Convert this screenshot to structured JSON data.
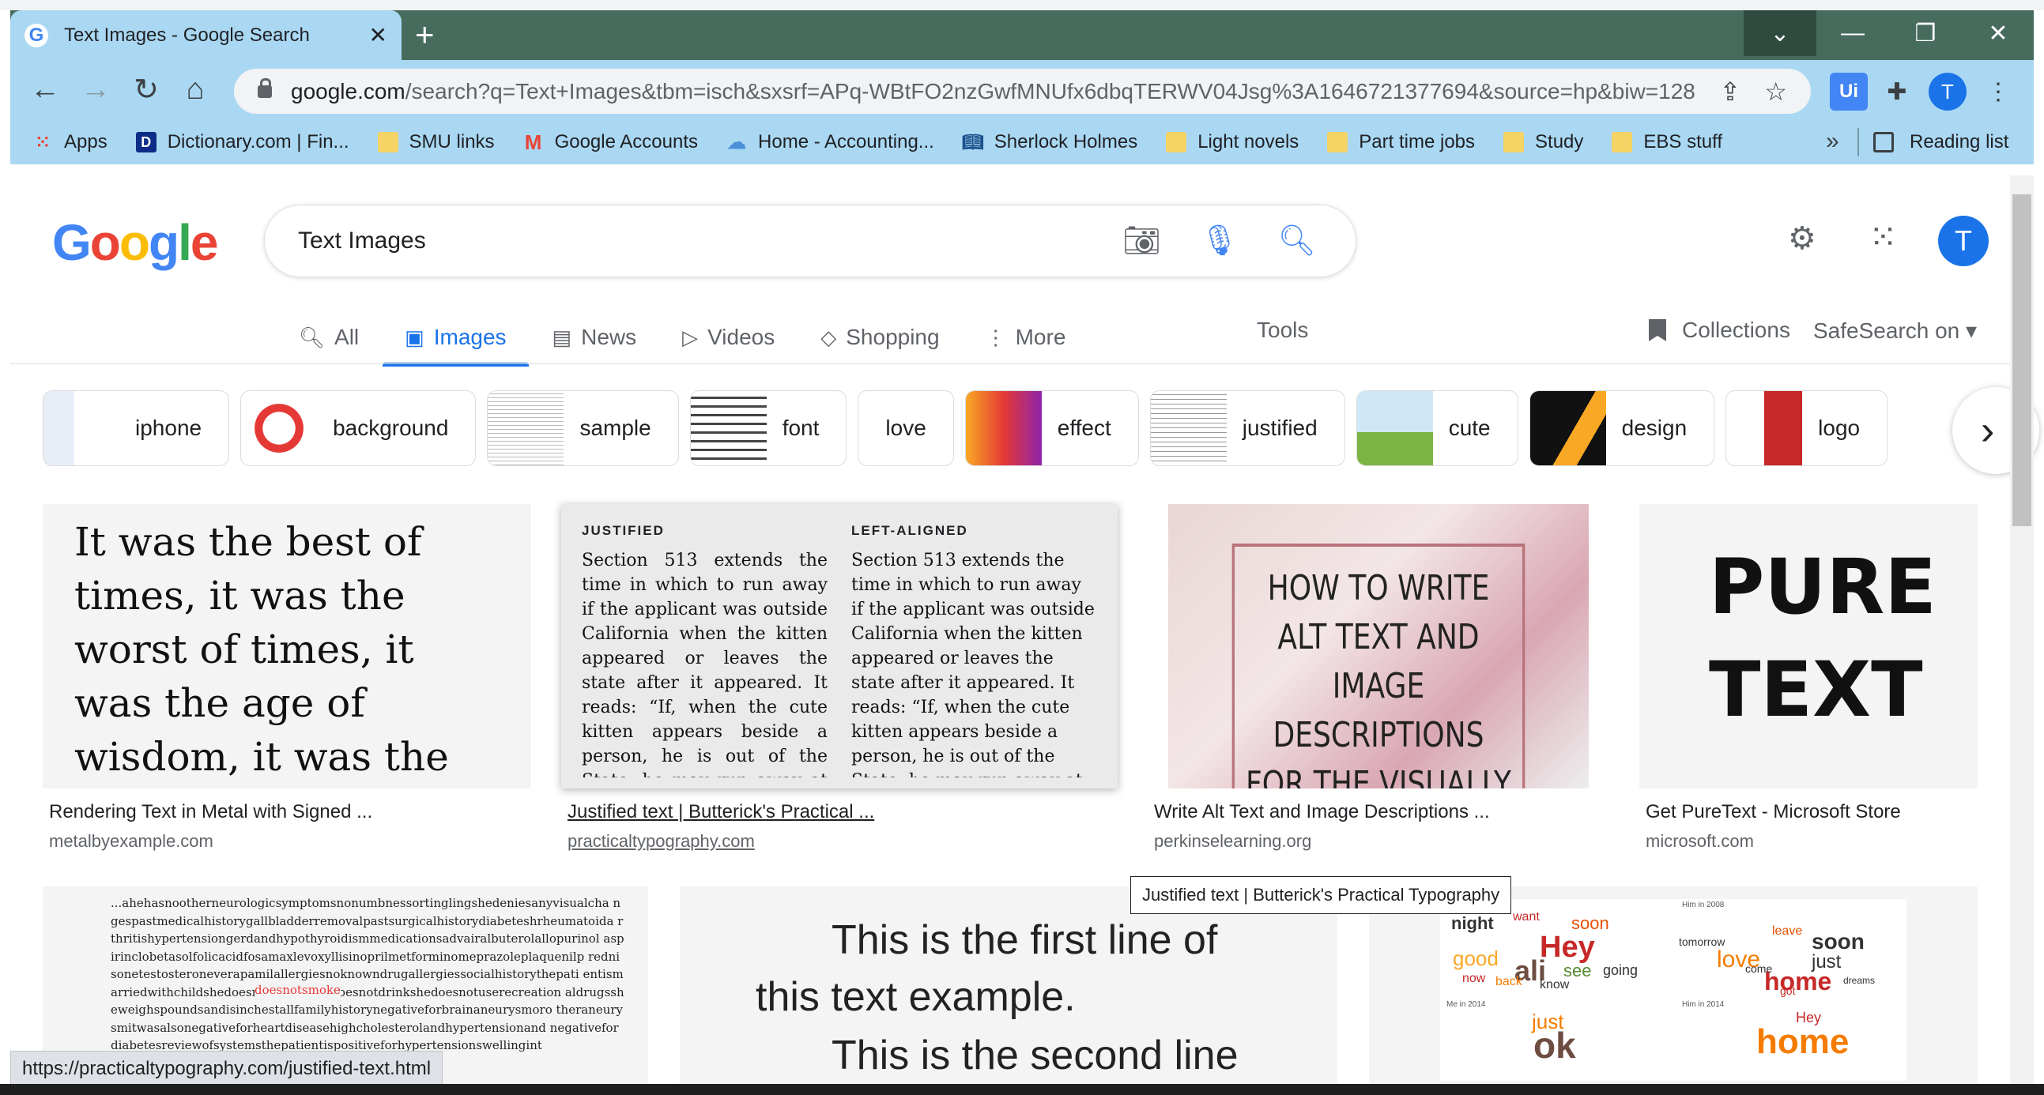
{
  "browser": {
    "tab_title": "Text Images - Google Search",
    "tab_close": "✕",
    "new_tab": "+",
    "url_host": "google.com",
    "url_rest": "/search?q=Text+Images&tbm=isch&sxsrf=APq-WBtFO2nzGwfMNUfx6dbqTERWV04Jsg%3A1646721377694&source=hp&biw=128...",
    "profile_initial": "T",
    "bookmarks": [
      {
        "label": "Apps",
        "icon": "apps-grid-icon"
      },
      {
        "label": "Dictionary.com | Fin...",
        "icon": "dictionary-icon"
      },
      {
        "label": "SMU links",
        "icon": "folder-icon"
      },
      {
        "label": "Google Accounts",
        "icon": "gmail-icon"
      },
      {
        "label": "Home - Accounting...",
        "icon": "cloud-icon"
      },
      {
        "label": "Sherlock Holmes",
        "icon": "book-icon"
      },
      {
        "label": "Light novels",
        "icon": "folder-icon"
      },
      {
        "label": "Part time jobs",
        "icon": "folder-icon"
      },
      {
        "label": "Study",
        "icon": "folder-icon"
      },
      {
        "label": "EBS stuff",
        "icon": "folder-icon"
      }
    ],
    "bookmarks_overflow": "»",
    "reading_list": "Reading list"
  },
  "search": {
    "query": "Text Images",
    "avatar_initial": "T",
    "tabs": [
      {
        "label": "All",
        "icon": "🔍︎",
        "active": false
      },
      {
        "label": "Images",
        "icon": "▣",
        "active": true
      },
      {
        "label": "News",
        "icon": "▤",
        "active": false
      },
      {
        "label": "Videos",
        "icon": "▷",
        "active": false
      },
      {
        "label": "Shopping",
        "icon": "◇",
        "active": false
      },
      {
        "label": "More",
        "icon": "⋮",
        "active": false
      }
    ],
    "tools": "Tools",
    "collections": "Collections",
    "safesearch": "SafeSearch on ▾"
  },
  "chips": [
    "iphone",
    "background",
    "sample",
    "font",
    "love",
    "effect",
    "justified",
    "cute",
    "design",
    "logo"
  ],
  "results": [
    {
      "caption": "Rendering Text in Metal with Signed ...",
      "source": "metalbyexample.com",
      "text": "It was the best of times, it was the worst of times, it was the age of wisdom, it was the age of foolishness..."
    },
    {
      "caption": "Justified text | Butterick's Practical ...",
      "source": "practicaltypography.com",
      "head_left": "JUSTIFIED",
      "head_right": "LEFT-ALIGNED",
      "body": "Section 513 extends the time in which to run away if the applicant was outside California when the kitten appeared or leaves the state after it appeared. It reads: “If, when the cute kitten appears beside a person, he is out of the State, he may run away at the earliest"
    },
    {
      "caption": "Write Alt Text and Image Descriptions ...",
      "source": "perkinselearning.org",
      "text": "HOW TO WRITE ALT TEXT AND IMAGE DESCRIPTIONS FOR THE VISUALLY IMPAIRED"
    },
    {
      "caption": "Get PureText - Microsoft Store",
      "source": "microsoft.com",
      "line1": "PURE",
      "line2": "TEXT"
    }
  ],
  "row2": {
    "dense_text": "...ahehasnootherneurologicsymptomsnonumbnessortinglingshedeniesanyvisualcha ngespastmedicalhistorygallbladderremovalpastsurgicalhistorydiabeteshrheumatoida rthritishypertensiongerdandhypothyroidismmedicationsadvairalbuterolallopurinol aspirinclobetasolfolicacidfosamaxlevoxyllisinoprilmetforminomeprazoleplaquenilp rednisonetestosteroneverapamilallergiesnoknowndrugallergiessocialhistorythepati entismarriedwithchildshedoesnotsmokeshedoesnotdrinkshedoesnotuserecreation aldrugssheweighspoundsandisinchestallfamilyhistorynegativeforbrainaneurysmoro theraneurysmitwasalsonegativeforheartdiseasehighcholesterolandhypertensionand negativefordiabetesreviewofsystemsthepatientispositiveforhypertensionswellingint",
    "highlight": "doesnotsmoke",
    "line1": "This is the first line of",
    "line2": "this text example.",
    "line3": "This is the second line",
    "cloud_years": [
      "Him in 2008",
      "Me in 2014",
      "Him in 2014"
    ],
    "cloud_words_a": [
      "night",
      "want",
      "soon",
      "Hey",
      "good",
      "ali",
      "see",
      "going",
      "now",
      "back",
      "know"
    ],
    "cloud_words_b": [
      "tomorrow",
      "leave",
      "soon",
      "love",
      "just",
      "home",
      "come",
      "got",
      "dreams"
    ],
    "cloud_words_c": [
      "just",
      "ok"
    ],
    "cloud_words_d": [
      "Hey",
      "home"
    ]
  },
  "tooltip": "Justified text | Butterick's Practical Typography",
  "status_url": "https://practicaltypography.com/justified-text.html"
}
